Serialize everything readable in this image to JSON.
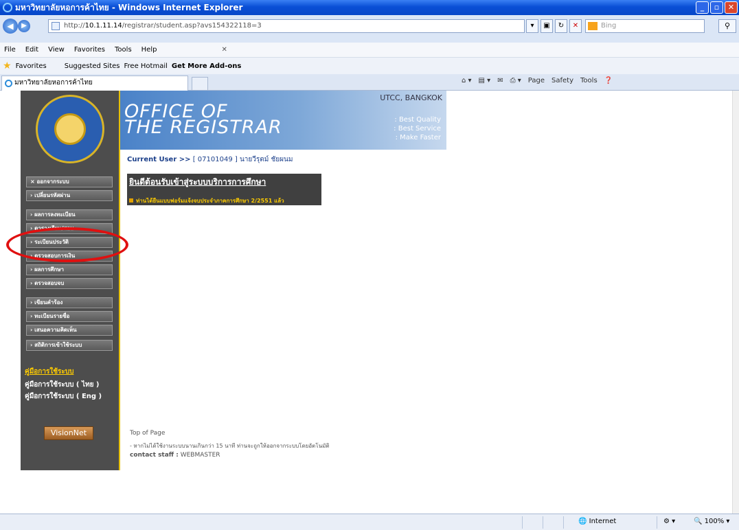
{
  "window": {
    "title": "มหาวิทยาลัยหอการค้าไทย - Windows Internet Explorer"
  },
  "address": {
    "url_prefix": "http://",
    "url_host": "10.1.11.14",
    "url_path": "/registrar/student.asp?avs154322118=3",
    "search_placeholder": "Bing"
  },
  "menubar": [
    "File",
    "Edit",
    "View",
    "Favorites",
    "Tools",
    "Help"
  ],
  "favorites": {
    "label": "Favorites",
    "suggested": "Suggested Sites",
    "hotmail": "Free Hotmail",
    "addons": "Get More Add-ons"
  },
  "tab": {
    "title": "มหาวิทยาลัยหอการค้าไทย"
  },
  "commandbar": [
    "Page",
    "Safety",
    "Tools"
  ],
  "sidebar": {
    "menu": [
      "× ออกจากระบบ",
      "› เปลี่ยนรหัสผ่าน",
      "› ผลการลงทะเบียน",
      "› ตารางเรียน/สอบ",
      "› ระเบียนประวัติ",
      "› ตรวจสอบการเงิน",
      "› ผลการศึกษา",
      "› ตรวจสอบจบ",
      "› เขียนคำร้อง",
      "› ทะเบียนรายชื่อ",
      "› เสนอความคิดเห็น",
      "› สถิติการเข้าใช้ระบบ"
    ],
    "help_title": "คู่มือการใช้ระบบ",
    "help_links": [
      "คู่มือการใช้ระบบ ( ไทย )",
      "คู่มือการใช้ระบบ ( Eng )"
    ],
    "visionnet": "VisionNet"
  },
  "banner": {
    "line1": "OFFICE OF",
    "line2": "THE REGISTRAR",
    "location": "UTCC, BANGKOK",
    "q1": ": Best Quality",
    "q2": ": Best Service",
    "q3": ": Make Faster"
  },
  "user": {
    "label": "Current User >>",
    "value": "[ 07101049 ] นายวีรุตม์ ชัยผนม"
  },
  "welcome": {
    "heading": "ยินดีต้อนรับเข้าสู่ระบบบริการการศึกษา",
    "message": "ท่านได้ยืนแบบฟอร์มแจ้งจบประจำภาคการศึกษา 2/2551 แล้ว"
  },
  "footer": {
    "top": "Top of Page",
    "note": "- หากไม่ได้ใช้งานระบบนานเกินกว่า 15 นาที ท่านจะถูกให้ออกจากระบบโดยอัตโนมัติ",
    "contact_label": "contact staff :",
    "contact": "WEBMASTER"
  },
  "status": {
    "zone": "Internet",
    "zoom": "100%"
  }
}
